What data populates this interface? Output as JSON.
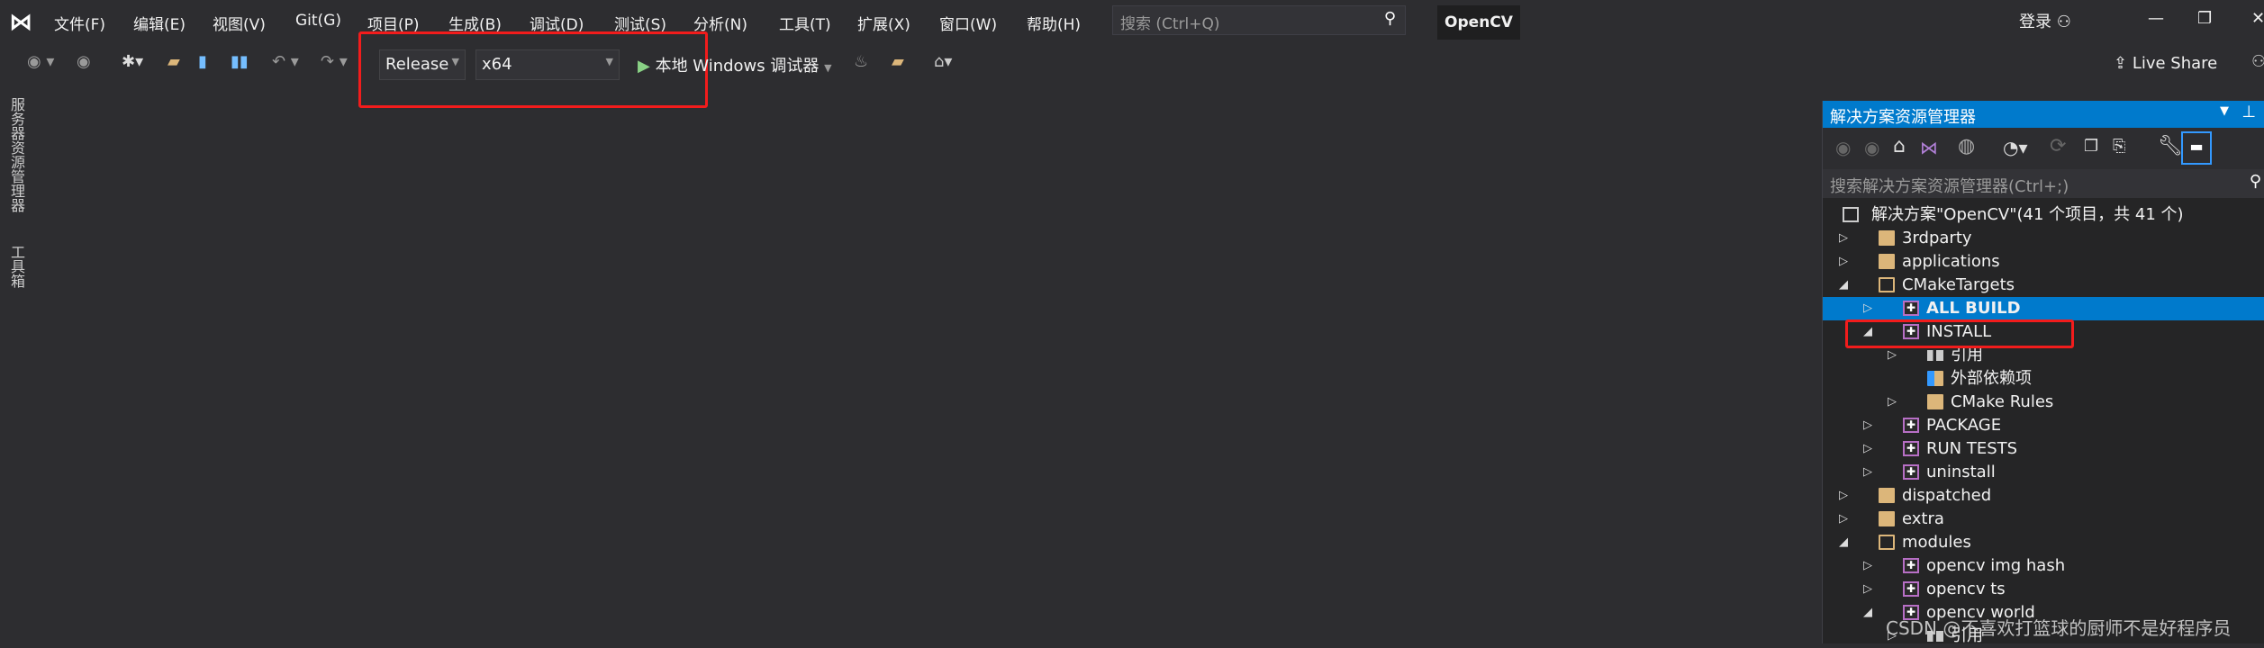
{
  "menu": [
    "文件(F)",
    "编辑(E)",
    "视图(V)",
    "Git(G)",
    "项目(P)",
    "生成(B)",
    "调试(D)",
    "测试(S)",
    "分析(N)",
    "工具(T)",
    "扩展(X)",
    "窗口(W)",
    "帮助(H)"
  ],
  "search": {
    "placeholder": "搜索 (Ctrl+Q)",
    "icon": "search-icon"
  },
  "project_name": "OpenCV",
  "login": "登录",
  "toolbar": {
    "config": "Release",
    "platform": "x64",
    "run_label": "本地 Windows 调试器",
    "live_share": "Live Share"
  },
  "left_tabs": [
    "服务器资源管理器",
    "工具箱"
  ],
  "solution_explorer": {
    "title": "解决方案资源管理器",
    "search_placeholder": "搜索解决方案资源管理器(Ctrl+;)",
    "items": [
      {
        "label": "解决方案\"OpenCV\"(41 个项目，共 41 个)",
        "level": 0,
        "type": "solution",
        "state": "none"
      },
      {
        "label": "3rdparty",
        "level": 1,
        "type": "folder",
        "state": "collapsed"
      },
      {
        "label": "applications",
        "level": 1,
        "type": "folder",
        "state": "collapsed"
      },
      {
        "label": "CMakeTargets",
        "level": 1,
        "type": "folder-open",
        "state": "expanded"
      },
      {
        "label": "ALL BUILD",
        "level": 2,
        "type": "project",
        "state": "collapsed",
        "selected": true
      },
      {
        "label": "INSTALL",
        "level": 2,
        "type": "project",
        "state": "expanded"
      },
      {
        "label": "引用",
        "level": 3,
        "type": "references",
        "state": "collapsed"
      },
      {
        "label": "外部依赖项",
        "level": 3,
        "type": "external",
        "state": "none"
      },
      {
        "label": "CMake Rules",
        "level": 3,
        "type": "filter",
        "state": "collapsed"
      },
      {
        "label": "PACKAGE",
        "level": 2,
        "type": "project",
        "state": "collapsed"
      },
      {
        "label": "RUN TESTS",
        "level": 2,
        "type": "project",
        "state": "collapsed"
      },
      {
        "label": "uninstall",
        "level": 2,
        "type": "project",
        "state": "collapsed"
      },
      {
        "label": "dispatched",
        "level": 1,
        "type": "folder",
        "state": "collapsed"
      },
      {
        "label": "extra",
        "level": 1,
        "type": "folder",
        "state": "collapsed"
      },
      {
        "label": "modules",
        "level": 1,
        "type": "folder-open",
        "state": "expanded"
      },
      {
        "label": "opencv img hash",
        "level": 2,
        "type": "project",
        "state": "collapsed"
      },
      {
        "label": "opencv ts",
        "level": 2,
        "type": "project",
        "state": "collapsed"
      },
      {
        "label": "opencv world",
        "level": 2,
        "type": "project",
        "state": "expanded"
      },
      {
        "label": "引用",
        "level": 3,
        "type": "references",
        "state": "collapsed"
      }
    ]
  },
  "watermark": "CSDN @不喜欢打篮球的厨师不是好程序员",
  "colors": {
    "accent": "#007acc",
    "highlight": "#f21c1c",
    "background": "#2d2d30",
    "panel": "#252526"
  }
}
